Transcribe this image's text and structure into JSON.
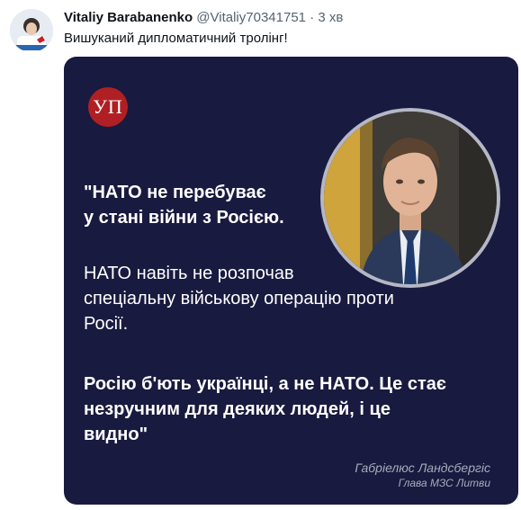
{
  "tweet": {
    "author_name": "Vitaliy Barabanenko",
    "author_handle": "@Vitaliy70341751",
    "separator": "·",
    "timestamp": "3 хв",
    "text": "Вишуканий дипломатичний тролінг!"
  },
  "card": {
    "logo_text": "УП",
    "quote_line_1": "\"НАТО не перебуває",
    "quote_line_2": "у стані війни з Росією.",
    "body_line_1": "НАТО навіть не розпочав",
    "body_line_2": "спеціальну військову операцію проти",
    "body_line_3": "Росії.",
    "closing_line_1": "Росію б'ють українці, а не НАТО. Це стає",
    "closing_line_2": "незручним для деяких людей, і це",
    "closing_line_3": "видно\"",
    "signature_name": "Габріелюс Ландсбергіс",
    "signature_title": "Глава МЗС Литви",
    "background_color": "#181a3f",
    "logo_color": "#b01f24"
  }
}
